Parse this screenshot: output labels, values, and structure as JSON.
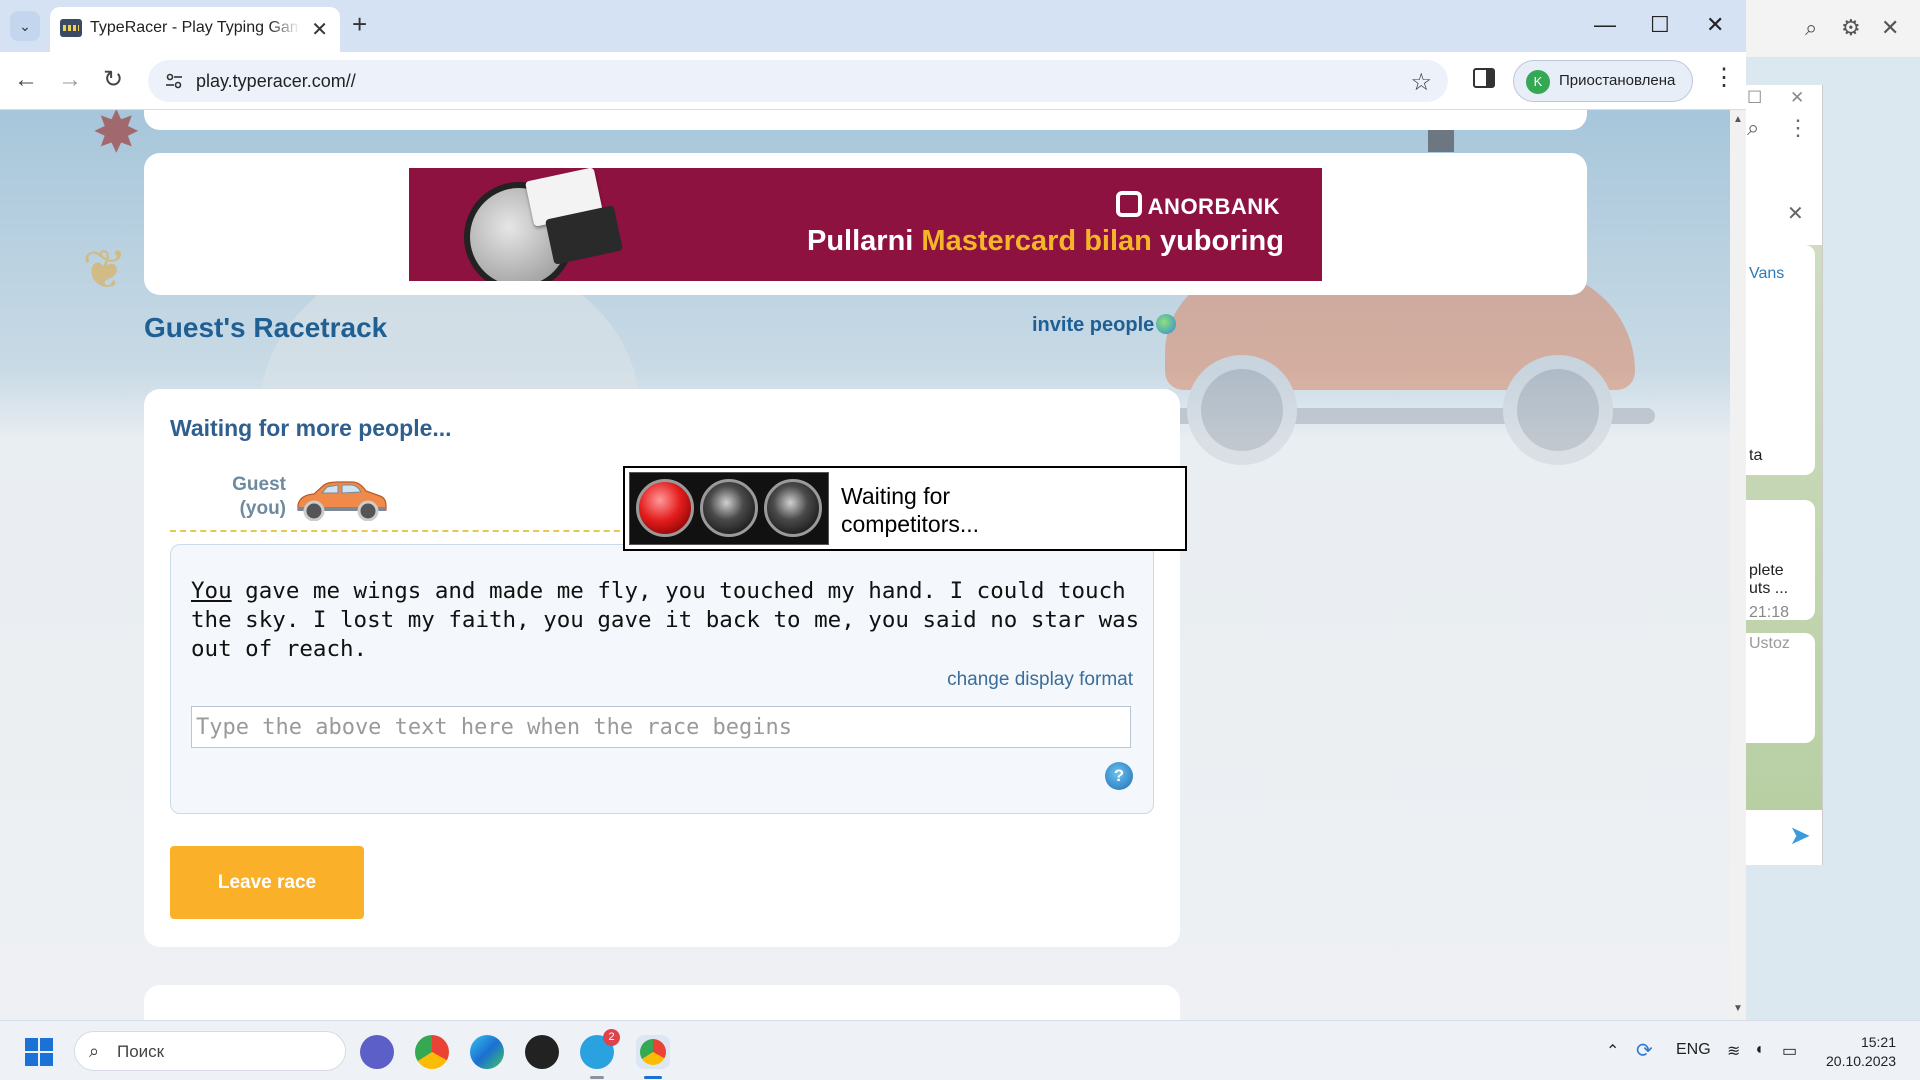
{
  "browser": {
    "tab_title": "TypeRacer - Play Typing Games",
    "new_tab_symbol": "+",
    "url": "play.typeracer.com//",
    "profile_initial": "K",
    "profile_label": "Приостановлена",
    "window_controls": {
      "minimize": "—",
      "maximize": "☐",
      "close": "✕"
    }
  },
  "ad": {
    "brand": "ANORBANK",
    "slogan_pre": "Pullarni ",
    "slogan_highlight": "Mastercard bilan",
    "slogan_post": " yuboring"
  },
  "race": {
    "racetrack_title": "Guest's Racetrack",
    "invite_label": "invite people",
    "status": "Waiting for more people...",
    "racer_name": "Guest",
    "racer_tag": "(you)",
    "traffic_light_text": "Waiting for competitors...",
    "passage_current_word": "You",
    "passage_rest": " gave me wings and made me fly, you touched my hand. I could touch the sky. I lost my faith, you gave it back to me, you said no star was out of reach.",
    "change_format_label": "change display format",
    "input_placeholder": "Type the above text here when the race begins",
    "help_symbol": "?",
    "leave_button": "Leave race"
  },
  "side_window": {
    "snippets": [
      "Vans",
      "ta",
      "plete",
      "uts ...",
      "21:18",
      "Ustoz"
    ]
  },
  "taskbar": {
    "search_placeholder": "Поиск",
    "telegram_badge": "2",
    "language": "ENG",
    "time": "15:21",
    "date": "20.10.2023"
  },
  "colors": {
    "brand_blue": "#1f5f94",
    "button_orange": "#fbb02a",
    "ad_background": "#8e1240",
    "ad_highlight": "#f4b629",
    "light_red": "#e41d1d"
  },
  "icons": [
    "tab-search-icon",
    "typeracer-favicon",
    "back-arrow-icon",
    "forward-arrow-icon",
    "reload-icon",
    "site-info-icon",
    "bookmark-star-icon",
    "side-panel-icon",
    "kebab-menu-icon",
    "invite-plus-icon",
    "car-icon",
    "help-icon",
    "windows-start-icon",
    "search-icon"
  ]
}
